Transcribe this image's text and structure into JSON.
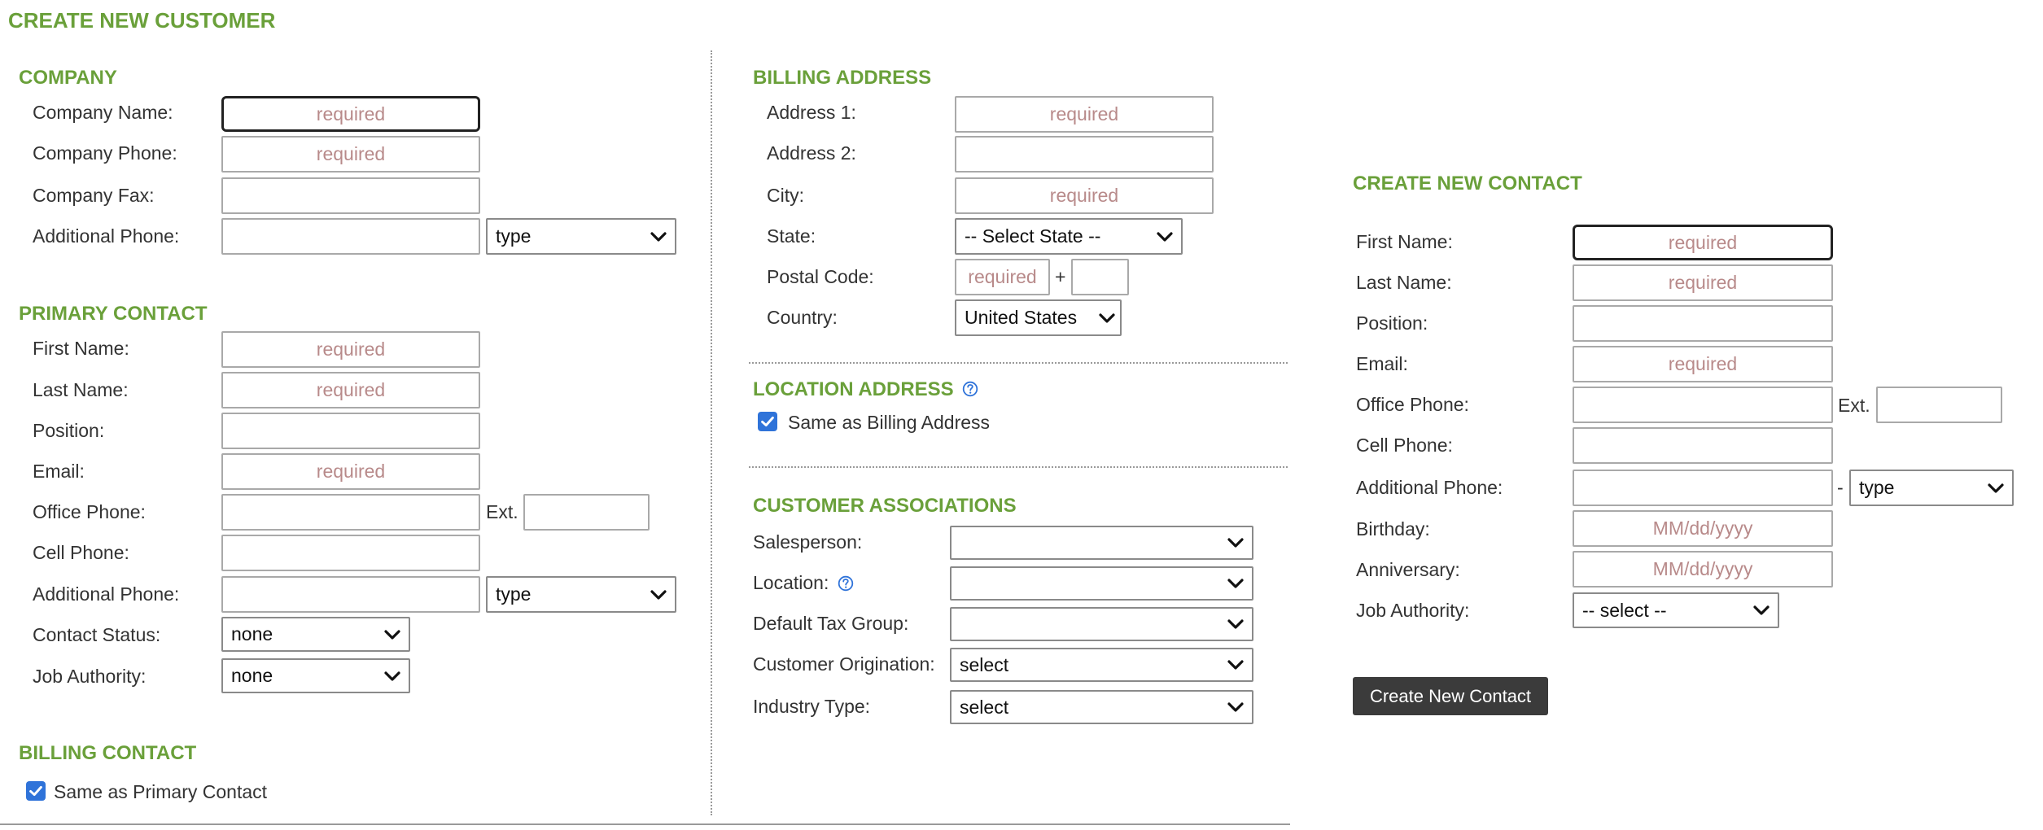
{
  "page": {
    "title": "CREATE NEW CUSTOMER"
  },
  "placeholders": {
    "required": "required",
    "date": "MM/dd/yyyy"
  },
  "company": {
    "title": "COMPANY",
    "name_label": "Company Name:",
    "phone_label": "Company Phone:",
    "fax_label": "Company Fax:",
    "additional_phone_label": "Additional Phone:",
    "additional_phone_type": "type"
  },
  "primary_contact": {
    "title": "PRIMARY CONTACT",
    "first_name_label": "First Name:",
    "last_name_label": "Last Name:",
    "position_label": "Position:",
    "email_label": "Email:",
    "office_phone_label": "Office Phone:",
    "ext_label": "Ext.",
    "cell_phone_label": "Cell Phone:",
    "additional_phone_label": "Additional Phone:",
    "additional_phone_type": "type",
    "contact_status_label": "Contact Status:",
    "contact_status_value": "none",
    "job_authority_label": "Job Authority:",
    "job_authority_value": "none"
  },
  "billing_contact": {
    "title": "BILLING CONTACT",
    "same_as_label": "Same as Primary Contact",
    "same_as_checked": true
  },
  "billing_address": {
    "title": "BILLING ADDRESS",
    "address1_label": "Address 1:",
    "address2_label": "Address 2:",
    "city_label": "City:",
    "state_label": "State:",
    "state_value": "-- Select State --",
    "postal_label": "Postal Code:",
    "postal_plus": "+",
    "country_label": "Country:",
    "country_value": "United States"
  },
  "location_address": {
    "title": "LOCATION ADDRESS",
    "same_as_label": "Same as Billing Address",
    "same_as_checked": true
  },
  "customer_associations": {
    "title": "CUSTOMER ASSOCIATIONS",
    "salesperson_label": "Salesperson:",
    "salesperson_value": "",
    "location_label": "Location:",
    "location_value": "",
    "tax_group_label": "Default Tax Group:",
    "tax_group_value": "",
    "origination_label": "Customer Origination:",
    "origination_value": "select",
    "industry_label": "Industry Type:",
    "industry_value": "select"
  },
  "new_contact": {
    "title": "CREATE NEW CONTACT",
    "first_name_label": "First Name:",
    "last_name_label": "Last Name:",
    "position_label": "Position:",
    "email_label": "Email:",
    "office_phone_label": "Office Phone:",
    "ext_label": "Ext.",
    "cell_phone_label": "Cell Phone:",
    "additional_phone_label": "Additional Phone:",
    "additional_phone_dash": "-",
    "additional_phone_type": "type",
    "birthday_label": "Birthday:",
    "anniversary_label": "Anniversary:",
    "job_authority_label": "Job Authority:",
    "job_authority_value": "-- select --",
    "create_button": "Create New Contact"
  },
  "colors": {
    "accent": "#6aa03a",
    "checkbox": "#2f73d9",
    "placeholder": "#b88a8a",
    "button": "#3b3b3b"
  },
  "icons": {
    "select": "chevron-down-icon",
    "help": "help-circle-icon",
    "checkbox": "checkmark-icon"
  }
}
